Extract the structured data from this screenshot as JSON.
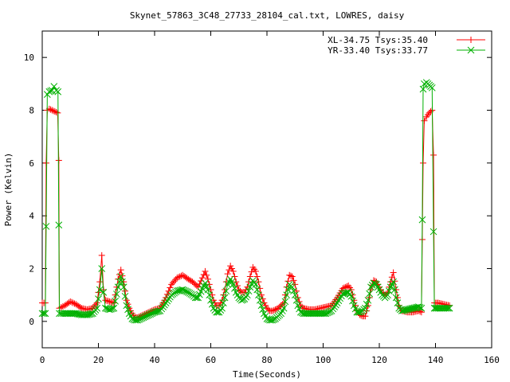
{
  "chart_data": {
    "type": "line",
    "title": "Skynet_57863_3C48_27733_28104_cal.txt, LOWRES, daisy",
    "xlabel": "Time(Seconds)",
    "ylabel": "Power (Kelvin)",
    "xlim": [
      0,
      160
    ],
    "ylim": [
      -1,
      11
    ],
    "xticks": [
      0,
      20,
      40,
      60,
      80,
      100,
      120,
      140,
      160
    ],
    "yticks": [
      0,
      2,
      4,
      6,
      8,
      10
    ],
    "grid": false,
    "legend_position": "top-right",
    "series": [
      {
        "name": "XL-34.75 Tsys:35.40",
        "color": "#ff0000",
        "marker": "plus",
        "points": [
          [
            0,
            0.7
          ],
          [
            0.6,
            0.7
          ],
          [
            1.1,
            0.7
          ],
          [
            1.4,
            6.0
          ],
          [
            1.8,
            8.0
          ],
          [
            2.5,
            8.05
          ],
          [
            3.5,
            8.0
          ],
          [
            4.5,
            7.95
          ],
          [
            5.5,
            7.9
          ],
          [
            5.9,
            6.1
          ],
          [
            6.1,
            0.5
          ],
          [
            8,
            0.6
          ],
          [
            10,
            0.75
          ],
          [
            12,
            0.65
          ],
          [
            14,
            0.5
          ],
          [
            16,
            0.45
          ],
          [
            18,
            0.5
          ],
          [
            19.5,
            0.7
          ],
          [
            20.5,
            1.5
          ],
          [
            21.2,
            2.5
          ],
          [
            21.8,
            1.2
          ],
          [
            22.5,
            0.8
          ],
          [
            24,
            0.75
          ],
          [
            25.5,
            0.7
          ],
          [
            27,
            1.6
          ],
          [
            28,
            1.95
          ],
          [
            29,
            1.5
          ],
          [
            30,
            0.8
          ],
          [
            31,
            0.5
          ],
          [
            32,
            0.3
          ],
          [
            33,
            0.15
          ],
          [
            34,
            0.15
          ],
          [
            35,
            0.2
          ],
          [
            36,
            0.25
          ],
          [
            37,
            0.3
          ],
          [
            38,
            0.35
          ],
          [
            39,
            0.4
          ],
          [
            40,
            0.45
          ],
          [
            42,
            0.5
          ],
          [
            44,
            0.9
          ],
          [
            46,
            1.4
          ],
          [
            48,
            1.65
          ],
          [
            50,
            1.75
          ],
          [
            52,
            1.6
          ],
          [
            53.5,
            1.5
          ],
          [
            54.5,
            1.4
          ],
          [
            55.5,
            1.3
          ],
          [
            57,
            1.65
          ],
          [
            58,
            1.9
          ],
          [
            59,
            1.6
          ],
          [
            60,
            1.2
          ],
          [
            61,
            0.8
          ],
          [
            62,
            0.6
          ],
          [
            63,
            0.6
          ],
          [
            64,
            0.8
          ],
          [
            65,
            1.2
          ],
          [
            66,
            1.8
          ],
          [
            67,
            2.1
          ],
          [
            68,
            1.9
          ],
          [
            69,
            1.5
          ],
          [
            70,
            1.2
          ],
          [
            71,
            1.1
          ],
          [
            72,
            1.1
          ],
          [
            73,
            1.3
          ],
          [
            74,
            1.7
          ],
          [
            75,
            2.05
          ],
          [
            76,
            1.9
          ],
          [
            77,
            1.5
          ],
          [
            78,
            1.0
          ],
          [
            79,
            0.7
          ],
          [
            80,
            0.5
          ],
          [
            81,
            0.4
          ],
          [
            82,
            0.4
          ],
          [
            83,
            0.45
          ],
          [
            84,
            0.5
          ],
          [
            85,
            0.6
          ],
          [
            86,
            0.7
          ],
          [
            87,
            1.3
          ],
          [
            88,
            1.75
          ],
          [
            89,
            1.7
          ],
          [
            90,
            1.4
          ],
          [
            91,
            0.9
          ],
          [
            92,
            0.6
          ],
          [
            93,
            0.5
          ],
          [
            95,
            0.45
          ],
          [
            97,
            0.45
          ],
          [
            99,
            0.5
          ],
          [
            101,
            0.55
          ],
          [
            103,
            0.6
          ],
          [
            105,
            0.9
          ],
          [
            107,
            1.25
          ],
          [
            109,
            1.35
          ],
          [
            110,
            1.2
          ],
          [
            111,
            0.8
          ],
          [
            112,
            0.4
          ],
          [
            113,
            0.25
          ],
          [
            114,
            0.2
          ],
          [
            115,
            0.2
          ],
          [
            116,
            0.6
          ],
          [
            117,
            1.2
          ],
          [
            118,
            1.55
          ],
          [
            119,
            1.5
          ],
          [
            120,
            1.3
          ],
          [
            121,
            1.1
          ],
          [
            122,
            1.0
          ],
          [
            123,
            1.1
          ],
          [
            124,
            1.5
          ],
          [
            125,
            1.85
          ],
          [
            126,
            1.2
          ],
          [
            127,
            0.6
          ],
          [
            128,
            0.4
          ],
          [
            130,
            0.35
          ],
          [
            132,
            0.35
          ],
          [
            134,
            0.4
          ],
          [
            135,
            0.35
          ],
          [
            135.3,
            3.1
          ],
          [
            135.6,
            6.0
          ],
          [
            136,
            7.6
          ],
          [
            136.8,
            7.75
          ],
          [
            137.8,
            7.9
          ],
          [
            138.8,
            8.0
          ],
          [
            139.3,
            6.3
          ],
          [
            139.6,
            0.7
          ],
          [
            141,
            0.7
          ],
          [
            143,
            0.65
          ],
          [
            145,
            0.6
          ]
        ]
      },
      {
        "name": "YR-33.40 Tsys:33.77",
        "color": "#00b000",
        "marker": "cross",
        "points": [
          [
            0,
            0.3
          ],
          [
            0.6,
            0.3
          ],
          [
            1.1,
            0.3
          ],
          [
            1.4,
            3.6
          ],
          [
            1.8,
            8.6
          ],
          [
            2.5,
            8.7
          ],
          [
            3.5,
            8.75
          ],
          [
            4.2,
            8.9
          ],
          [
            5,
            8.75
          ],
          [
            5.6,
            8.7
          ],
          [
            5.9,
            3.65
          ],
          [
            6.1,
            0.3
          ],
          [
            8,
            0.3
          ],
          [
            10,
            0.3
          ],
          [
            12,
            0.3
          ],
          [
            14,
            0.25
          ],
          [
            16,
            0.25
          ],
          [
            18,
            0.3
          ],
          [
            19.5,
            0.5
          ],
          [
            20.5,
            1.2
          ],
          [
            21.2,
            2.0
          ],
          [
            21.8,
            1.1
          ],
          [
            22.5,
            0.5
          ],
          [
            24,
            0.45
          ],
          [
            25.5,
            0.5
          ],
          [
            27,
            1.3
          ],
          [
            28,
            1.7
          ],
          [
            29,
            1.3
          ],
          [
            30,
            0.6
          ],
          [
            31,
            0.3
          ],
          [
            32,
            0.1
          ],
          [
            33,
            0.05
          ],
          [
            34,
            0.05
          ],
          [
            35,
            0.1
          ],
          [
            36,
            0.15
          ],
          [
            37,
            0.2
          ],
          [
            38,
            0.25
          ],
          [
            39,
            0.3
          ],
          [
            40,
            0.35
          ],
          [
            42,
            0.4
          ],
          [
            44,
            0.7
          ],
          [
            46,
            1.0
          ],
          [
            48,
            1.15
          ],
          [
            50,
            1.2
          ],
          [
            52,
            1.1
          ],
          [
            53.5,
            1.0
          ],
          [
            54.5,
            0.9
          ],
          [
            55.5,
            0.9
          ],
          [
            57,
            1.25
          ],
          [
            58,
            1.45
          ],
          [
            59,
            1.2
          ],
          [
            60,
            0.8
          ],
          [
            61,
            0.5
          ],
          [
            62,
            0.35
          ],
          [
            63,
            0.35
          ],
          [
            64,
            0.5
          ],
          [
            65,
            0.9
          ],
          [
            66,
            1.4
          ],
          [
            67,
            1.6
          ],
          [
            68,
            1.4
          ],
          [
            69,
            1.1
          ],
          [
            70,
            0.9
          ],
          [
            71,
            0.8
          ],
          [
            72,
            0.85
          ],
          [
            73,
            1.0
          ],
          [
            74,
            1.3
          ],
          [
            75,
            1.55
          ],
          [
            76,
            1.4
          ],
          [
            77,
            1.0
          ],
          [
            78,
            0.6
          ],
          [
            79,
            0.3
          ],
          [
            80,
            0.1
          ],
          [
            81,
            0.05
          ],
          [
            82,
            0.05
          ],
          [
            83,
            0.1
          ],
          [
            84,
            0.2
          ],
          [
            85,
            0.3
          ],
          [
            86,
            0.5
          ],
          [
            87,
            1.0
          ],
          [
            88,
            1.4
          ],
          [
            89,
            1.3
          ],
          [
            90,
            1.0
          ],
          [
            91,
            0.6
          ],
          [
            92,
            0.35
          ],
          [
            93,
            0.3
          ],
          [
            95,
            0.3
          ],
          [
            97,
            0.3
          ],
          [
            99,
            0.3
          ],
          [
            101,
            0.3
          ],
          [
            103,
            0.4
          ],
          [
            105,
            0.7
          ],
          [
            107,
            1.05
          ],
          [
            109,
            1.1
          ],
          [
            110,
            0.95
          ],
          [
            111,
            0.6
          ],
          [
            112,
            0.35
          ],
          [
            113,
            0.35
          ],
          [
            114,
            0.4
          ],
          [
            115,
            0.5
          ],
          [
            116,
            0.8
          ],
          [
            117,
            1.3
          ],
          [
            118,
            1.45
          ],
          [
            119,
            1.4
          ],
          [
            120,
            1.2
          ],
          [
            121,
            1.0
          ],
          [
            122,
            0.9
          ],
          [
            123,
            1.0
          ],
          [
            124,
            1.3
          ],
          [
            125,
            1.5
          ],
          [
            126,
            0.9
          ],
          [
            127,
            0.5
          ],
          [
            128,
            0.4
          ],
          [
            130,
            0.45
          ],
          [
            132,
            0.5
          ],
          [
            134,
            0.55
          ],
          [
            135,
            0.5
          ],
          [
            135.3,
            3.85
          ],
          [
            135.6,
            8.8
          ],
          [
            136,
            9.0
          ],
          [
            136.8,
            9.05
          ],
          [
            137.8,
            8.95
          ],
          [
            138.8,
            8.85
          ],
          [
            139.3,
            3.4
          ],
          [
            139.6,
            0.5
          ],
          [
            141,
            0.5
          ],
          [
            143,
            0.5
          ],
          [
            145,
            0.5
          ]
        ]
      }
    ]
  }
}
